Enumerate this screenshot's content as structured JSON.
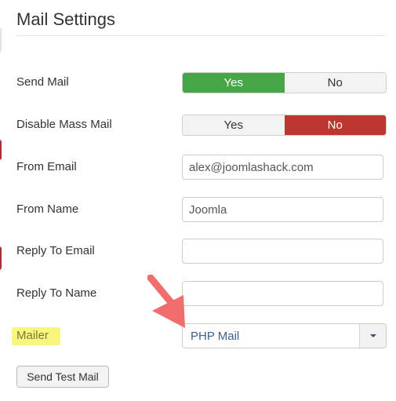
{
  "section": {
    "title": "Mail Settings"
  },
  "fields": {
    "send_mail": {
      "label": "Send Mail",
      "options": [
        "Yes",
        "No"
      ],
      "selected": "Yes"
    },
    "disable_mass_mail": {
      "label": "Disable Mass Mail",
      "options": [
        "Yes",
        "No"
      ],
      "selected": "No"
    },
    "from_email": {
      "label": "From Email",
      "value": "alex@joomlashack.com"
    },
    "from_name": {
      "label": "From Name",
      "value": "Joomla"
    },
    "reply_to_email": {
      "label": "Reply To Email",
      "value": ""
    },
    "reply_to_name": {
      "label": "Reply To Name",
      "value": ""
    },
    "mailer": {
      "label": "Mailer",
      "selected": "PHP Mail"
    }
  },
  "actions": {
    "send_test_mail": "Send Test Mail"
  },
  "annotations": {
    "arrow_icon": "arrow-pointing-to-mailer",
    "highlight_color": "#f5f56a",
    "arrow_color": "#f26d6d"
  },
  "colors": {
    "yes_active": "#46a546",
    "no_active": "#bd362f",
    "select_text": "#3b5f8a"
  }
}
